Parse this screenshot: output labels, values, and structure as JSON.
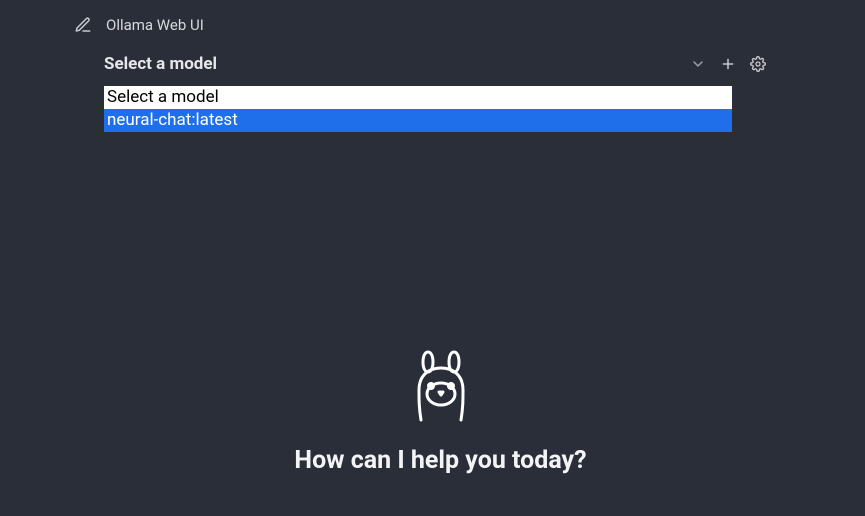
{
  "app": {
    "title": "Ollama Web UI"
  },
  "model_selector": {
    "label": "Select a model",
    "options": [
      {
        "label": "Select a model",
        "selected": false
      },
      {
        "label": "neural-chat:latest",
        "selected": true
      }
    ]
  },
  "icons": {
    "edit": "edit-icon",
    "chevron_down": "chevron-down-icon",
    "plus": "plus-icon",
    "gear": "gear-icon"
  },
  "hero": {
    "title": "How can I help you today?"
  },
  "colors": {
    "background": "#2a2e38",
    "highlight": "#1f6fea",
    "text": "#e5e7eb"
  }
}
